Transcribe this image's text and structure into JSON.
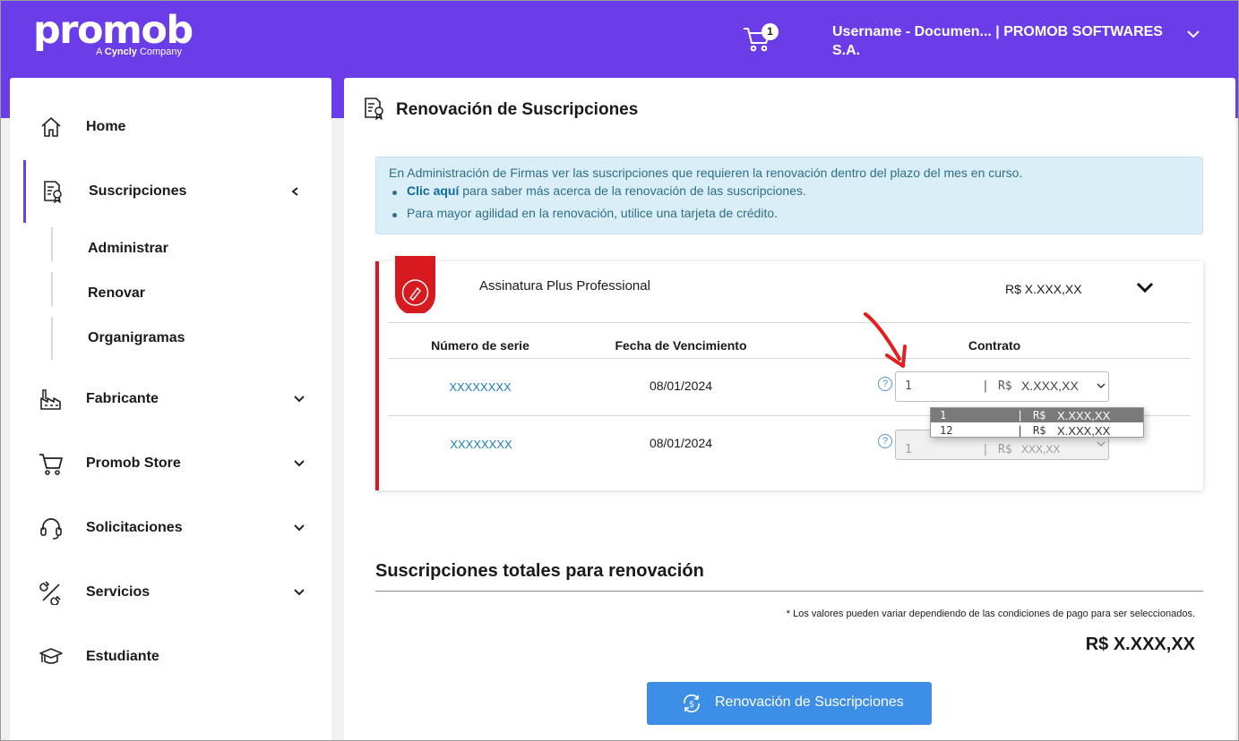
{
  "brand": {
    "logo_text": "promob",
    "tagline_prefix": "A",
    "tagline_brand": "Cyncly",
    "tagline_suffix": "Company"
  },
  "header": {
    "cart_count": "1",
    "user_line1": "Username - Documen... | PROMOB SOFTWARES",
    "user_line2": "S.A."
  },
  "sidebar": {
    "items": [
      {
        "label": "Home",
        "icon": "home-icon"
      },
      {
        "label": "Suscripciones",
        "icon": "subscription-icon"
      },
      {
        "label": "Fabricante",
        "icon": "factory-icon"
      },
      {
        "label": "Promob Store",
        "icon": "cart-icon"
      },
      {
        "label": "Solicitaciones",
        "icon": "headset-icon"
      },
      {
        "label": "Servicios",
        "icon": "tools-icon"
      },
      {
        "label": "Estudiante",
        "icon": "graduation-cap-icon"
      }
    ],
    "sub_items": [
      {
        "label": "Administrar"
      },
      {
        "label": "Renovar"
      },
      {
        "label": "Organigramas"
      }
    ]
  },
  "page": {
    "title": "Renovación de Suscripciones",
    "info": {
      "line": "En Administración de Firmas ver las suscripciones que requieren la renovación dentro del plazo del mes en curso.",
      "link": "Clic aquí",
      "bullet1_rest": " para saber más acerca de la renovación de las suscripciones.",
      "bullet2": "Para mayor agilidad en la renovación, utilice una tarjeta de crédito."
    },
    "subscription": {
      "name": "Assinatura Plus Professional",
      "price": "R$ X.XXX,XX",
      "columns": [
        "Número de serie",
        "Fecha de Vencimiento",
        "Contrato"
      ],
      "rows": [
        {
          "serial": "XXXXXXXX",
          "date": "08/01/2024",
          "qty": "1",
          "sep": "|",
          "currency": "R$",
          "amount": "X.XXX,XX"
        },
        {
          "serial": "XXXXXXXX",
          "date": "08/01/2024",
          "qty": "1",
          "sep": "|",
          "currency": "R$",
          "amount": "XXX,XX"
        }
      ],
      "dropdown_options": [
        {
          "qty": "1",
          "sep": "|",
          "currency": "R$",
          "amount": "X.XXX,XX",
          "selected": true
        },
        {
          "qty": "12",
          "sep": "|",
          "currency": "R$",
          "amount": "X.XXX,XX",
          "selected": false
        }
      ]
    },
    "totals": {
      "title": "Suscripciones totales para renovación",
      "disclaimer": "* Los valores pueden variar dependiendo de las condiciones de pago para ser seleccionados.",
      "currency": "R$",
      "amount": "X.XXX,XX"
    },
    "renew_button": "Renovación de Suscripciones"
  },
  "colors": {
    "brand": "#6a3de8",
    "accent_red": "#d61a1f",
    "button": "#3d8ee6",
    "info_bg": "#d9eef6"
  }
}
